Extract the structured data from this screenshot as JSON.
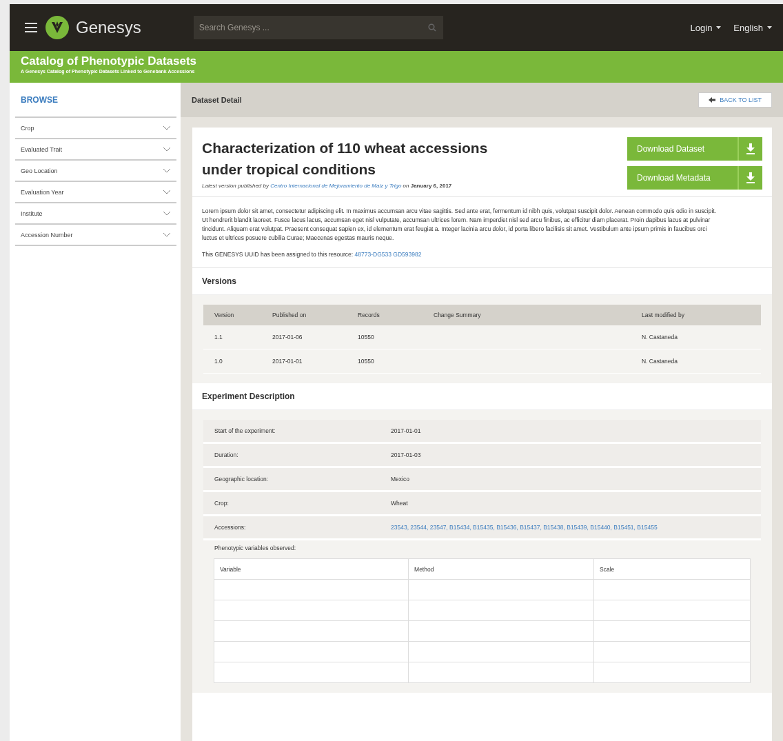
{
  "header": {
    "brand": "Genesys",
    "search": {
      "placeholder": "Search Genesys ..."
    },
    "menus": [
      "Login",
      "English"
    ]
  },
  "banner": {
    "title": "Catalog of Phenotypic Datasets",
    "subtitle": "A Genesys Catalog of Phenotypic Datasets Linked to Genebank Accessions"
  },
  "sidebar": {
    "title": "BROWSE",
    "items": [
      {
        "label": "Crop",
        "expanded": false
      },
      {
        "label": "Evaluated Trait",
        "expanded": false
      },
      {
        "label": "Geo Location",
        "expanded": false
      },
      {
        "label": "Evaluation Year",
        "expanded": false
      },
      {
        "label": "Institute",
        "expanded": false
      },
      {
        "label": "Accession Number",
        "expanded": false
      }
    ]
  },
  "toolbar": {
    "title": "Dataset Detail",
    "back_button": "BACK TO LIST"
  },
  "dataset": {
    "title": "Characterization of 110 wheat accessions under tropical conditions",
    "published": {
      "prefix": "Latest version published by",
      "publisher": "Centro Internacional de Mejoramiento de Maiz y Trigo",
      "on": "on",
      "date": "January 6, 2017"
    },
    "downloads": [
      "Download Dataset",
      "Download Metadata"
    ],
    "description": "Lorem ipsum dolor sit amet, consectetur adipiscing elit. In maximus accumsan arcu vitae sagittis. Sed ante erat, fermentum id nibh quis, volutpat suscipit dolor. Aenean commodo quis odio in suscipit. Ut hendrerit blandit laoreet. Fusce lacus lacus, accumsan eget nisl vulputate, accumsan ultrices lorem. Nam imperdiet nisl sed arcu finibus, ac efficitur diam placerat. Proin dapibus lacus at pulvinar tincidunt. Aliquam erat volutpat. Praesent consequat sapien ex, id elementum erat feugiat a. Integer lacinia arcu dolor, id porta libero facilisis sit amet. Vestibulum ante ipsum primis in faucibus orci luctus et ultrices posuere cubilia Curae; Maecenas egestas mauris neque.",
    "uuid": {
      "label": "This GENESYS UUID has been assigned to this resource:",
      "value": "48773-DG533 GD593982"
    }
  },
  "versions": {
    "title": "Versions",
    "columns": [
      "Version",
      "Published on",
      "Records",
      "Change Summary",
      "Last modified by"
    ],
    "rows": [
      [
        "1.1",
        "2017-01-06",
        "10550",
        "",
        "N. Castaneda"
      ],
      [
        "1.0",
        "2017-01-01",
        "10550",
        "",
        "N. Castaneda"
      ]
    ]
  },
  "experiment": {
    "title": "Experiment Description",
    "fields": [
      {
        "label": "Start of the experiment:",
        "value": "2017-01-01",
        "kind": "text"
      },
      {
        "label": "Duration:",
        "value": "2017-01-03",
        "kind": "text"
      },
      {
        "label": "Geographic location:",
        "value": "Mexico",
        "kind": "text"
      },
      {
        "label": "Crop:",
        "value": "Wheat",
        "kind": "text"
      },
      {
        "label": "Accessions:",
        "value": "23543, 23544, 23547, B15434, B15435, B15436, B15437, B15438, B15439, B15440, B15451, B15455",
        "kind": "link"
      }
    ],
    "variables_label": "Phenotypic variables observed:",
    "variables": {
      "columns": [
        "Variable",
        "Method",
        "Scale"
      ]
    }
  }
}
